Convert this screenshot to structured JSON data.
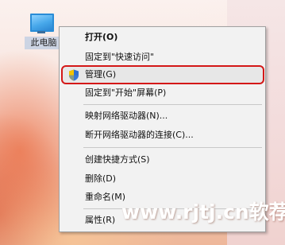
{
  "desktop": {
    "icon_label": "此电脑",
    "icon_name": "computer-icon"
  },
  "context_menu": {
    "items": [
      {
        "label": "打开(O)",
        "bold": true
      },
      {
        "label": "固定到\"快速访问\""
      },
      {
        "label": "管理(G)",
        "icon": "uac-shield-icon",
        "highlighted": true
      },
      {
        "label": "固定到\"开始\"屏幕(P)"
      },
      {
        "label": "映射网络驱动器(N)..."
      },
      {
        "label": "断开网络驱动器的连接(C)..."
      },
      {
        "label": "创建快捷方式(S)"
      },
      {
        "label": "删除(D)"
      },
      {
        "label": "重命名(M)"
      },
      {
        "label": "属性(R)"
      }
    ],
    "highlight_color": "#d41818"
  },
  "watermark": {
    "text": "www.rjtj.cn软荐网"
  }
}
